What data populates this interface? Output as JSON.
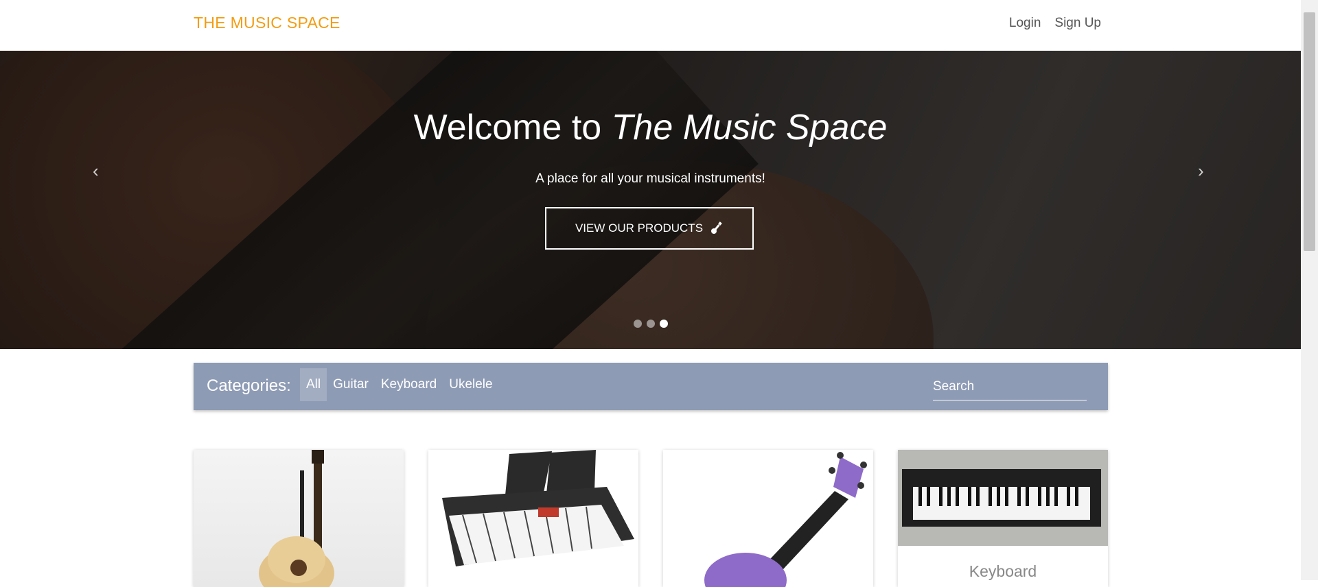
{
  "navbar": {
    "brand": "THE MUSIC SPACE",
    "links": [
      {
        "label": "Login"
      },
      {
        "label": "Sign Up"
      }
    ]
  },
  "hero": {
    "title_prefix": "Welcome to ",
    "title_emphasis": "The Music Space",
    "subtitle": "A place for all your musical instruments!",
    "button_label": "VIEW OUR PRODUCTS",
    "prev_arrow": "‹",
    "next_arrow": "›",
    "slide_count": 3,
    "active_slide": 3
  },
  "categories": {
    "label": "Categories:",
    "items": [
      {
        "label": "All",
        "active": true
      },
      {
        "label": "Guitar",
        "active": false
      },
      {
        "label": "Keyboard",
        "active": false
      },
      {
        "label": "Ukelele",
        "active": false
      }
    ],
    "search_placeholder": "Search"
  },
  "products": [
    {
      "image": "acoustic-guitar-image",
      "title": ""
    },
    {
      "image": "keyboard-image",
      "title": ""
    },
    {
      "image": "ukulele-image",
      "title": ""
    },
    {
      "image": "keyboard-image",
      "title": "Keyboard"
    }
  ],
  "colors": {
    "brand": "#f39c12",
    "category_bar": "#8e9bb5"
  }
}
